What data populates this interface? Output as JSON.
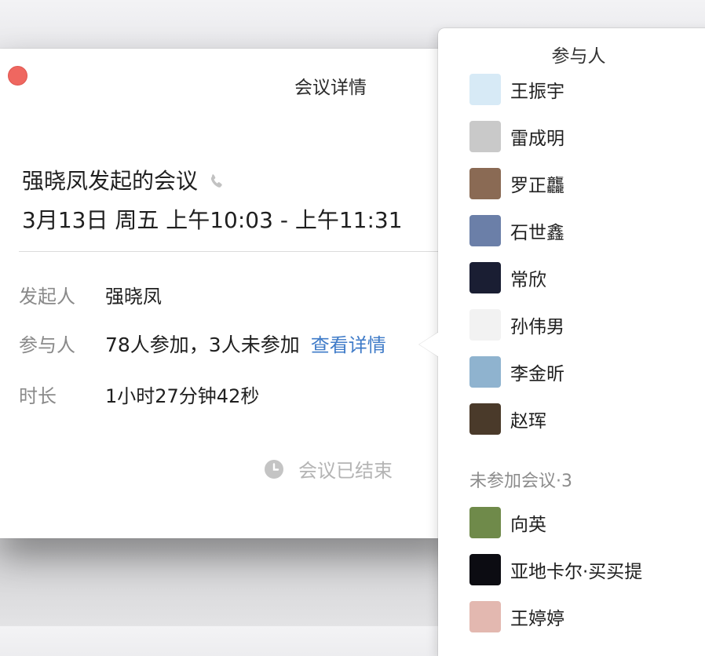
{
  "window": {
    "title": "会议详情",
    "meeting_title": "强晓凤发起的会议",
    "meeting_time": "3月13日 周五 上午10:03 - 上午11:31",
    "rows": {
      "initiator_label": "发起人",
      "initiator_value": "强晓凤",
      "participants_label": "参与人",
      "participants_value": "78人参加，3人未参加",
      "participants_link": "查看详情",
      "duration_label": "时长",
      "duration_value": "1小时27分钟42秒"
    },
    "status": "会议已结束"
  },
  "popover": {
    "title": "参与人",
    "attended": [
      {
        "name": "王振宇",
        "avatar": "avatar-balloon",
        "color": "#d7eaf6"
      },
      {
        "name": "雷成明",
        "avatar": "avatar-dog",
        "color": "#c9c9c9"
      },
      {
        "name": "罗正龘",
        "avatar": "avatar-photo-man",
        "color": "#8a6a54"
      },
      {
        "name": "石世鑫",
        "avatar": "avatar-anime",
        "color": "#6b7fa8"
      },
      {
        "name": "常欣",
        "avatar": "avatar-night",
        "color": "#1a1e33"
      },
      {
        "name": "孙伟男",
        "avatar": "avatar-cartoon-cat",
        "color": "#f2f2f2"
      },
      {
        "name": "李金昕",
        "avatar": "avatar-red-shirt",
        "color": "#8fb3cf"
      },
      {
        "name": "赵珲",
        "avatar": "avatar-lotus",
        "color": "#4a3a2a"
      }
    ],
    "absent_label": "未参加会议·3",
    "absent": [
      {
        "name": "向英",
        "avatar": "avatar-forest",
        "color": "#6f8a4a"
      },
      {
        "name": "亚地卡尔·买买提",
        "avatar": "avatar-black",
        "color": "#0c0c12"
      },
      {
        "name": "王婷婷",
        "avatar": "avatar-pink",
        "color": "#e3b8b0"
      }
    ]
  }
}
